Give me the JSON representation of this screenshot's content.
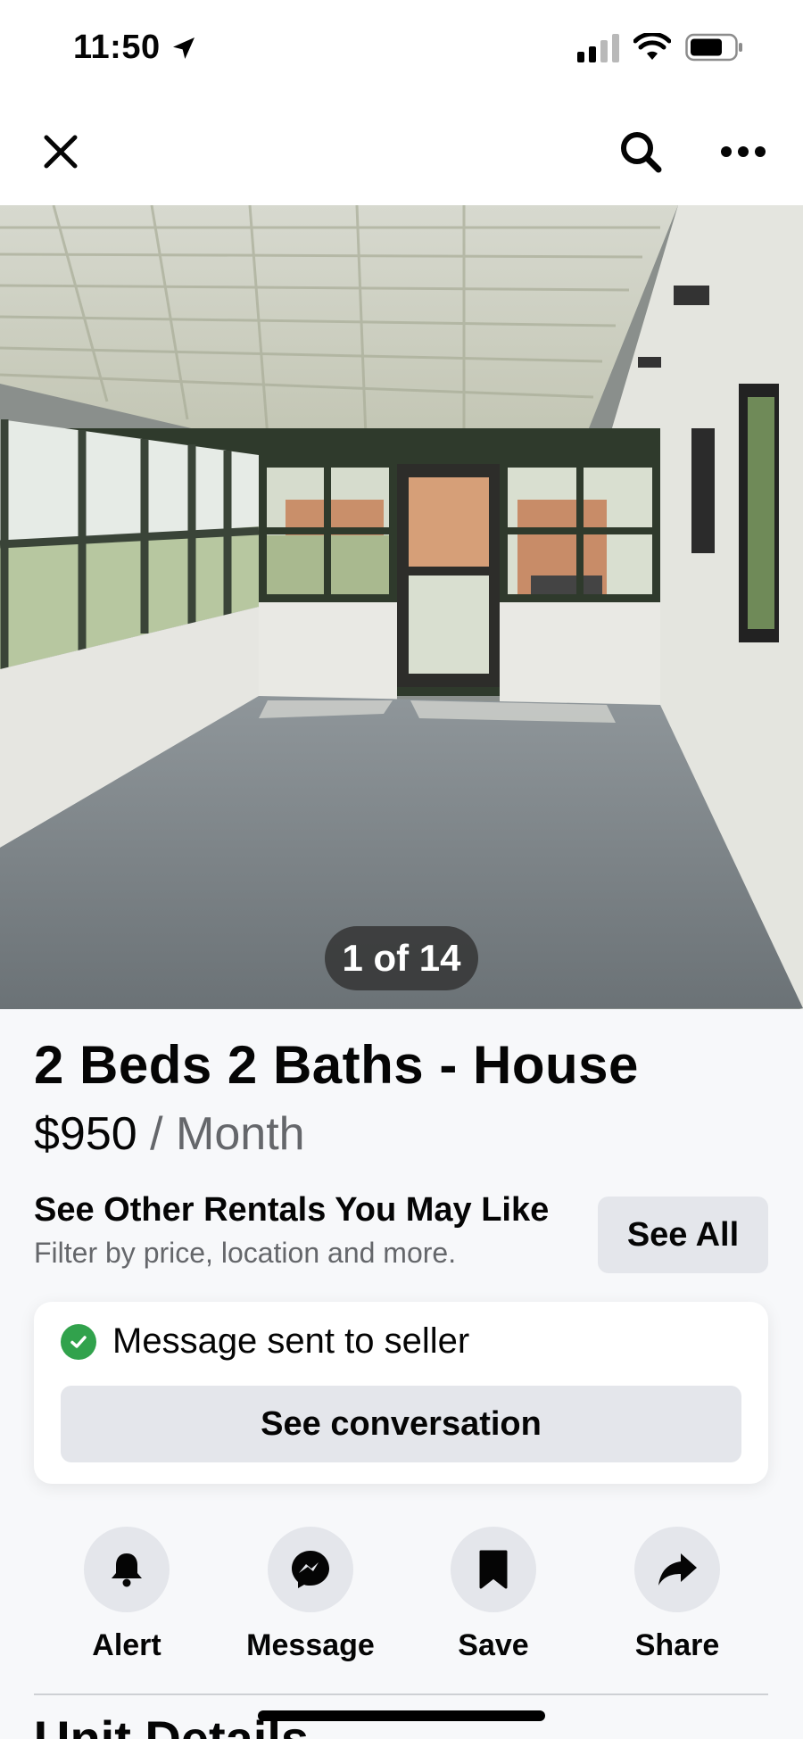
{
  "status_bar": {
    "time": "11:50"
  },
  "photo": {
    "counter": "1 of 14"
  },
  "listing": {
    "title": "2 Beds 2 Baths - House",
    "price": "$950",
    "price_period": "/ Month"
  },
  "rentals": {
    "heading": "See Other Rentals You May Like",
    "subtext": "Filter by price, location and more.",
    "see_all_label": "See All"
  },
  "message_card": {
    "status": "Message sent to seller",
    "button_label": "See conversation"
  },
  "actions": [
    {
      "label": "Alert",
      "icon": "bell-icon"
    },
    {
      "label": "Message",
      "icon": "messenger-icon"
    },
    {
      "label": "Save",
      "icon": "bookmark-icon"
    },
    {
      "label": "Share",
      "icon": "share-arrow-icon"
    }
  ],
  "next_section": {
    "heading": "Unit Details"
  },
  "colors": {
    "accent_green": "#31a24c",
    "button_gray": "#e4e6eb",
    "secondary_text": "#65676b"
  }
}
